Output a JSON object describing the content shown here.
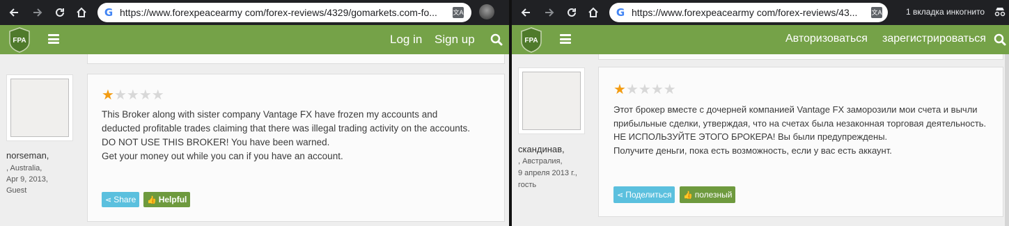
{
  "left": {
    "browser": {
      "url": "https://www.forexpeacearmy com/forex-reviews/4329/gomarkets.com-fo..."
    },
    "site": {
      "logo": "FPA",
      "login": "Log in",
      "signup": "Sign up"
    },
    "review": {
      "author": "norseman,",
      "location": ", Australia,",
      "date": "Apr 9, 2013,",
      "role": "Guest",
      "rating": 1,
      "lines": [
        "This Broker along with sister company Vantage FX have frozen my accounts and deducted profitable trades claiming that there was illegal trading activity on the accounts.",
        "DO NOT USE THIS BROKER! You have been warned.",
        "Get your money out while you can if you have an account."
      ],
      "share": "Share",
      "helpful": "Helpful"
    }
  },
  "right": {
    "browser": {
      "url": "https://www.forexpeacearmy com/forex-reviews/43...",
      "incognito": "1 вкладка инкогнито"
    },
    "site": {
      "logo": "FPA",
      "login": "Авторизоваться",
      "signup": "зарегистрироваться"
    },
    "review": {
      "author": "скандинав,",
      "location": ", Австралия,",
      "date": "9 апреля 2013 г.,",
      "role": "гость",
      "rating": 1,
      "lines": [
        "Этот брокер вместе с дочерней компанией Vantage FX заморозили мои счета и вычли прибыльные сделки, утверждая, что на счетах была незаконная торговая деятельность.",
        "НЕ ИСПОЛЬЗУЙТЕ ЭТОГО БРОКЕРА! Вы были предупреждены.",
        "Получите деньги, пока есть возможность, если у вас есть аккаунт."
      ],
      "share": "Поделиться",
      "helpful": "полезный"
    }
  },
  "colors": {
    "site_bar": "#75a248",
    "star": "#f39c12",
    "share_button": "#5bc0de",
    "helpful_button": "#6e9a3e"
  }
}
